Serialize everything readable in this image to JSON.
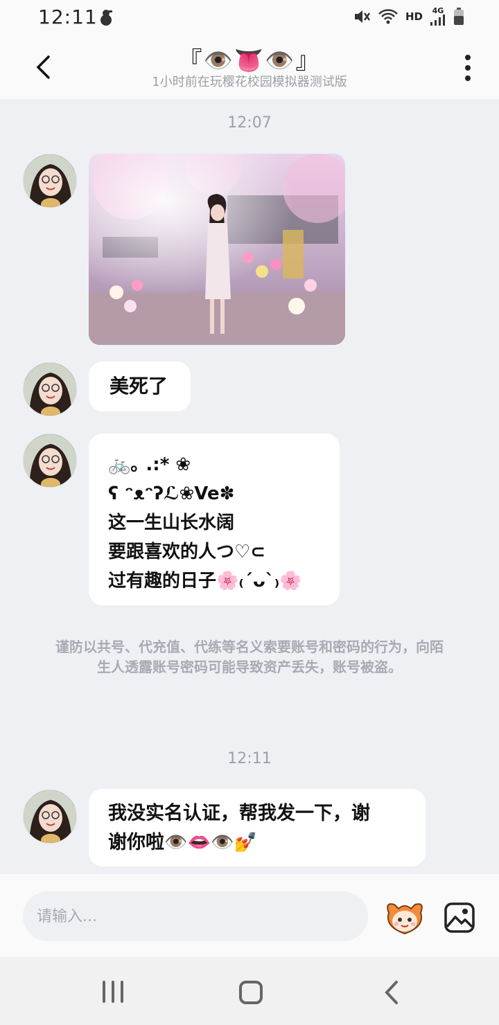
{
  "status_bar": {
    "time": "12:11",
    "network_label": "HD",
    "signal_label": "4G"
  },
  "header": {
    "title": "『👁️👅👁️』",
    "subtitle": "1小时前在玩樱花校园模拟器测试版"
  },
  "messages": {
    "timestamp1": "12:07",
    "text1": "美死了",
    "text2_lines": [
      "🚲｡ .:* ❀",
      " ʕ ̯•͡ˑ͓•̯᷅ʔℒ❀Ve✽",
      " 这一生山长水阔",
      " 要跟喜欢的人つ♡⊂",
      "过有趣的日子🌸₍ˊᴗˋ₎🌸"
    ],
    "text2_line1": "🚲｡ .:* ❀",
    "text2_line2": " ʕ ᵔᴥᵔʔℒ❀Ve✽",
    "text2_line3": " 这一生山长水阔",
    "text2_line4": " 要跟喜欢的人つ♡⊂",
    "text2_line5": "过有趣的日子🌸₍ˊᴗˋ₎🌸",
    "warning": "谨防以共号、代充值、代练等名义索要账号和密码的行为，向陌生人透露账号密码可能导致资产丢失，账号被盗。",
    "timestamp2": "12:11",
    "text3_line1": "我没实名认证，帮我发一下，谢",
    "text3_line2": "谢你啦👁️👄👁️💅"
  },
  "input": {
    "placeholder": "请输入..."
  },
  "icons": {
    "back": "chevron-left-icon",
    "menu": "more-vertical-icon",
    "emoji": "emoji-mascot-icon",
    "image": "image-icon"
  },
  "colors": {
    "background": "#eef0f4",
    "bubble": "#ffffff",
    "muted_text": "#9ba0a8"
  }
}
